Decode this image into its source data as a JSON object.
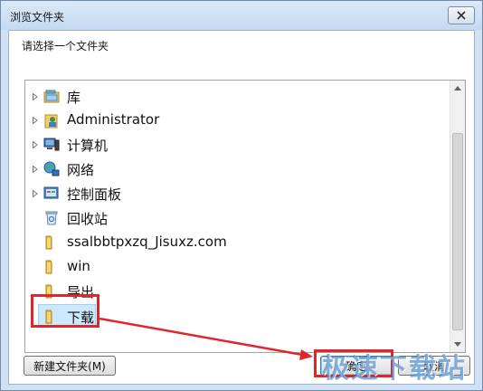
{
  "window": {
    "title": "浏览文件夹",
    "close_icon": "close-icon"
  },
  "prompt": "请选择一个文件夹",
  "tree": {
    "items": [
      {
        "label": "库",
        "icon": "library-icon",
        "expandable": true,
        "selected": false
      },
      {
        "label": "Administrator",
        "icon": "user-folder-icon",
        "expandable": true,
        "selected": false
      },
      {
        "label": "计算机",
        "icon": "computer-icon",
        "expandable": true,
        "selected": false
      },
      {
        "label": "网络",
        "icon": "network-icon",
        "expandable": true,
        "selected": false
      },
      {
        "label": "控制面板",
        "icon": "control-panel-icon",
        "expandable": true,
        "selected": false
      },
      {
        "label": "回收站",
        "icon": "recycle-bin-icon",
        "expandable": false,
        "selected": false
      },
      {
        "label": "ssalbbtpxzq_Jisuxz.com",
        "icon": "folder-icon",
        "expandable": false,
        "selected": false
      },
      {
        "label": "win",
        "icon": "folder-icon",
        "expandable": false,
        "selected": false
      },
      {
        "label": "导出",
        "icon": "folder-icon",
        "expandable": false,
        "selected": false
      },
      {
        "label": "下载",
        "icon": "folder-icon",
        "expandable": false,
        "selected": true
      }
    ]
  },
  "buttons": {
    "new_folder": "新建文件夹(M)",
    "ok": "确定",
    "cancel": "取消"
  },
  "watermark": "极速下载站",
  "colors": {
    "annotation_red": "#e0262a",
    "selection_bg": "#cde8ff",
    "title_bg": "#c4daf1"
  }
}
